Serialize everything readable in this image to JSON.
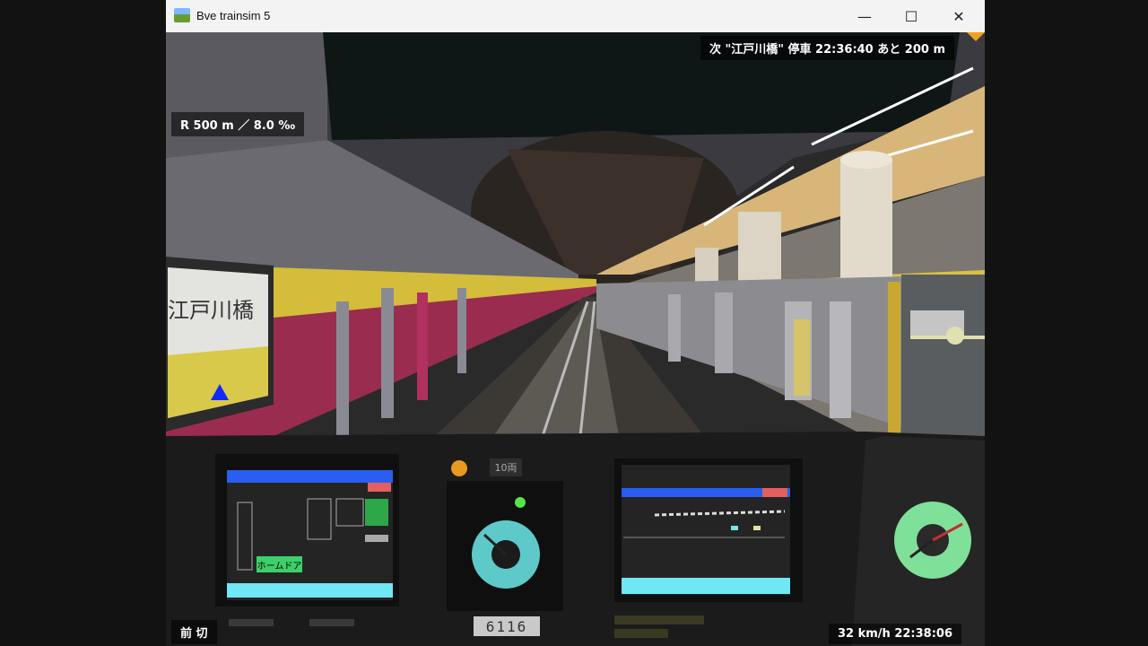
{
  "window": {
    "title": "Bve trainsim 5",
    "minimize_symbol": "—",
    "maximize_symbol": "☐",
    "close_symbol": "✕"
  },
  "hud": {
    "next_stop": "次 \"江戸川橋\" 停車 22:36:40 あと 200 m",
    "curve_gradient": "R 500 m ／ 8.0 ‰",
    "reverser_power": "前 切",
    "speed_time": "32 km/h 22:38:06"
  },
  "cab": {
    "home_door_label": "ホームドア",
    "car_count": "10両",
    "car_number": "6116"
  },
  "scene": {
    "station_sign": "江戸川橋"
  },
  "icons": {
    "app": "train-landscape-icon",
    "destination": "blue-triangle-icon",
    "signal": "orange-lamp-icon"
  },
  "colors": {
    "platform_stripe": "#d9c04a",
    "wall_pink": "#c8325f",
    "panel_header_blue": "#2a5ef0",
    "panel_footer_cyan": "#6fe7f5",
    "speedometer_face": "#5ec9c9"
  }
}
